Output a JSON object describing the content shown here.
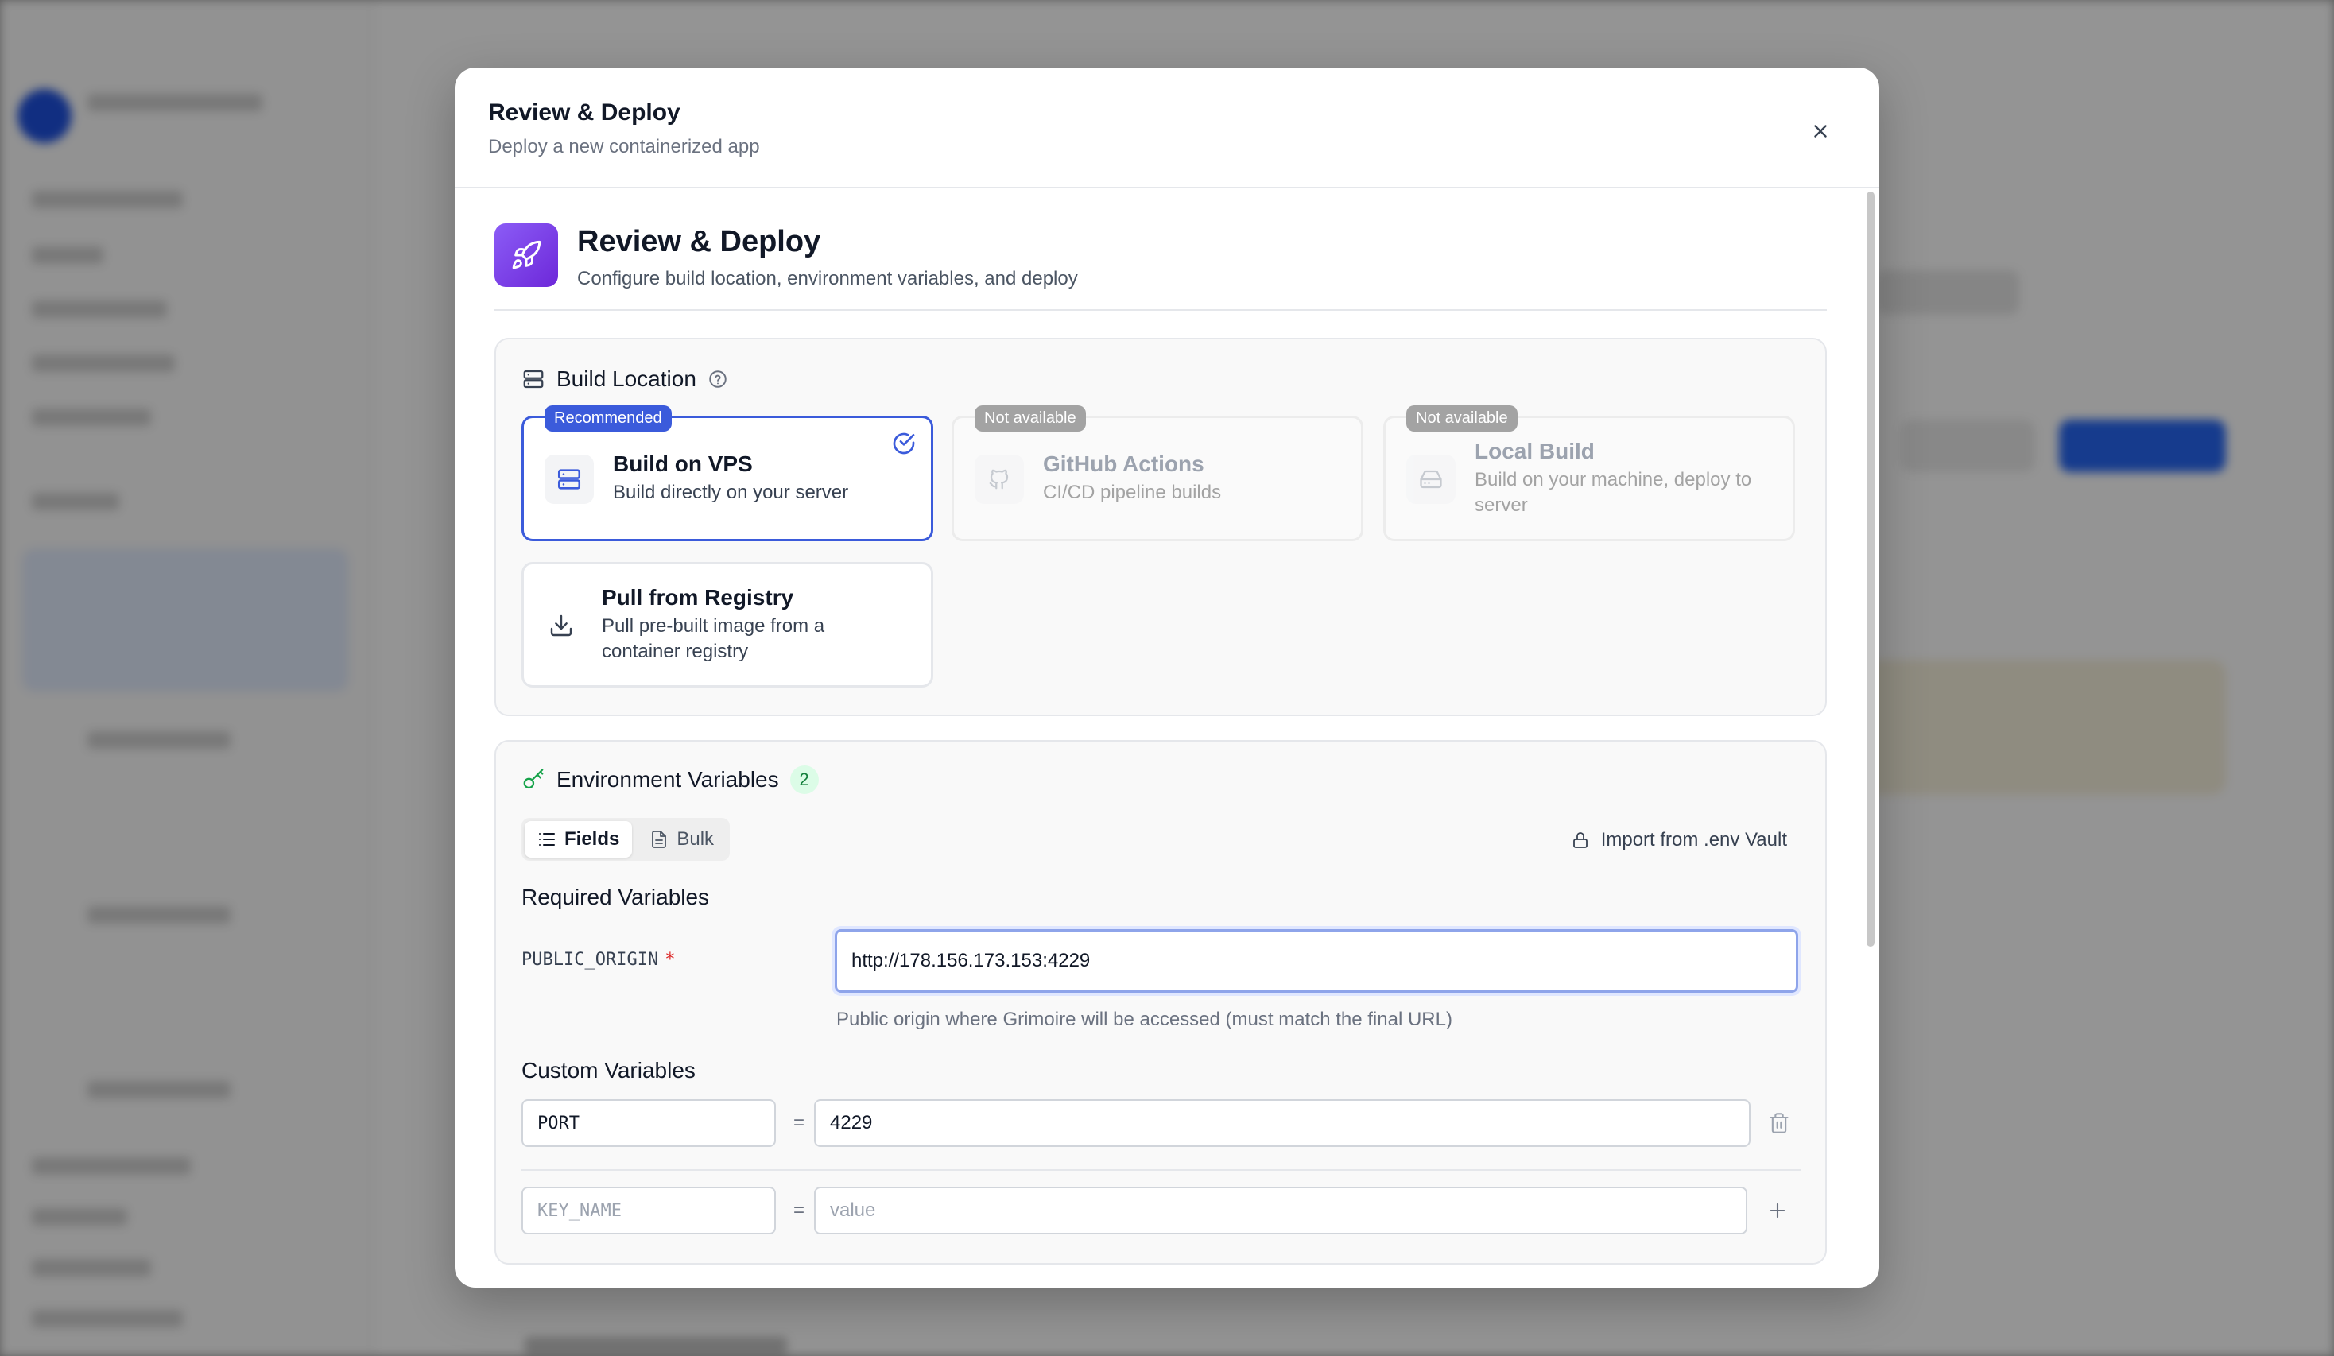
{
  "modal": {
    "title": "Review & Deploy",
    "subtitle": "Deploy a new containerized app"
  },
  "hero": {
    "title": "Review & Deploy",
    "subtitle": "Configure build location, environment variables, and deploy",
    "icon": "rocket-icon"
  },
  "build_location": {
    "title": "Build Location",
    "options": [
      {
        "badge": "Recommended",
        "name": "Build on VPS",
        "description": "Build directly on your server",
        "icon": "server-icon",
        "state": "selected"
      },
      {
        "badge": "Not available",
        "name": "GitHub Actions",
        "description": "CI/CD pipeline builds",
        "icon": "github-icon",
        "state": "disabled"
      },
      {
        "badge": "Not available",
        "name": "Local Build",
        "description": "Build on your machine, deploy to server",
        "icon": "hard-drive-icon",
        "state": "disabled"
      },
      {
        "badge": "",
        "name": "Pull from Registry",
        "description": "Pull pre-built image from a container registry",
        "icon": "download-icon",
        "state": "default"
      }
    ]
  },
  "env": {
    "title": "Environment Variables",
    "count": "2",
    "tabs": {
      "fields": "Fields",
      "bulk": "Bulk"
    },
    "active_tab": "Fields",
    "import_label": "Import from .env Vault",
    "required_heading": "Required Variables",
    "required": [
      {
        "name": "PUBLIC_ORIGIN",
        "required_mark": "*",
        "value": "http://178.156.173.153:4229",
        "helper": "Public origin where Grimoire will be accessed (must match the final URL)"
      }
    ],
    "custom_heading": "Custom Variables",
    "custom": [
      {
        "key": "PORT",
        "value": "4229"
      }
    ],
    "new_row": {
      "key_placeholder": "KEY_NAME",
      "value_placeholder": "value",
      "separator": "="
    }
  },
  "colors": {
    "accent": "#3b5bdb",
    "hero_gradient_start": "#8b5cf6",
    "hero_gradient_end": "#6d28d9",
    "success": "#15803d",
    "required": "#dc2626"
  }
}
